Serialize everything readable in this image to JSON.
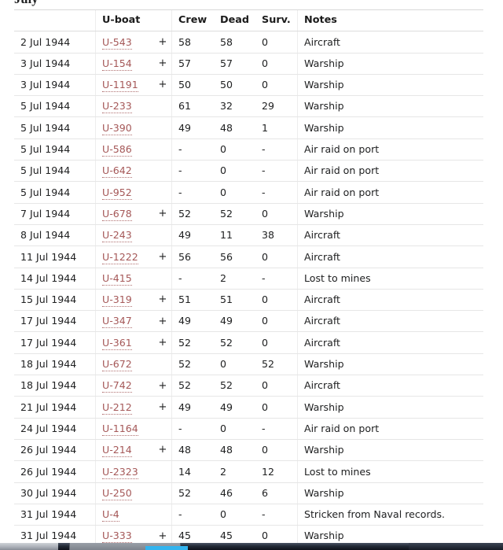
{
  "section": {
    "heading": "July"
  },
  "table": {
    "columns": [
      {
        "key": "date",
        "label": ""
      },
      {
        "key": "uboat",
        "label": "U-boat"
      },
      {
        "key": "cross",
        "label": ""
      },
      {
        "key": "crew",
        "label": "Crew"
      },
      {
        "key": "dead",
        "label": "Dead"
      },
      {
        "key": "surv",
        "label": "Surv."
      },
      {
        "key": "notes",
        "label": "Notes"
      }
    ],
    "rows": [
      {
        "date": "2 Jul 1944",
        "uboat": "U-543",
        "cross": "+",
        "crew": "58",
        "dead": "58",
        "surv": "0",
        "notes": "Aircraft"
      },
      {
        "date": "3 Jul 1944",
        "uboat": "U-154",
        "cross": "+",
        "crew": "57",
        "dead": "57",
        "surv": "0",
        "notes": "Warship"
      },
      {
        "date": "3 Jul 1944",
        "uboat": "U-1191",
        "cross": "+",
        "crew": "50",
        "dead": "50",
        "surv": "0",
        "notes": "Warship"
      },
      {
        "date": "5 Jul 1944",
        "uboat": "U-233",
        "cross": "",
        "crew": "61",
        "dead": "32",
        "surv": "29",
        "notes": "Warship"
      },
      {
        "date": "5 Jul 1944",
        "uboat": "U-390",
        "cross": "",
        "crew": "49",
        "dead": "48",
        "surv": "1",
        "notes": "Warship"
      },
      {
        "date": "5 Jul 1944",
        "uboat": "U-586",
        "cross": "",
        "crew": "-",
        "dead": "0",
        "surv": "-",
        "notes": "Air raid on port"
      },
      {
        "date": "5 Jul 1944",
        "uboat": "U-642",
        "cross": "",
        "crew": "-",
        "dead": "0",
        "surv": "-",
        "notes": "Air raid on port"
      },
      {
        "date": "5 Jul 1944",
        "uboat": "U-952",
        "cross": "",
        "crew": "-",
        "dead": "0",
        "surv": "-",
        "notes": "Air raid on port"
      },
      {
        "date": "7 Jul 1944",
        "uboat": "U-678",
        "cross": "+",
        "crew": "52",
        "dead": "52",
        "surv": "0",
        "notes": "Warship"
      },
      {
        "date": "8 Jul 1944",
        "uboat": "U-243",
        "cross": "",
        "crew": "49",
        "dead": "11",
        "surv": "38",
        "notes": "Aircraft"
      },
      {
        "date": "11 Jul 1944",
        "uboat": "U-1222",
        "cross": "+",
        "crew": "56",
        "dead": "56",
        "surv": "0",
        "notes": "Aircraft"
      },
      {
        "date": "14 Jul 1944",
        "uboat": "U-415",
        "cross": "",
        "crew": "-",
        "dead": "2",
        "surv": "-",
        "notes": "Lost to mines"
      },
      {
        "date": "15 Jul 1944",
        "uboat": "U-319",
        "cross": "+",
        "crew": "51",
        "dead": "51",
        "surv": "0",
        "notes": "Aircraft"
      },
      {
        "date": "17 Jul 1944",
        "uboat": "U-347",
        "cross": "+",
        "crew": "49",
        "dead": "49",
        "surv": "0",
        "notes": "Aircraft"
      },
      {
        "date": "17 Jul 1944",
        "uboat": "U-361",
        "cross": "+",
        "crew": "52",
        "dead": "52",
        "surv": "0",
        "notes": "Aircraft"
      },
      {
        "date": "18 Jul 1944",
        "uboat": "U-672",
        "cross": "",
        "crew": "52",
        "dead": "0",
        "surv": "52",
        "notes": "Warship"
      },
      {
        "date": "18 Jul 1944",
        "uboat": "U-742",
        "cross": "+",
        "crew": "52",
        "dead": "52",
        "surv": "0",
        "notes": "Aircraft"
      },
      {
        "date": "21 Jul 1944",
        "uboat": "U-212",
        "cross": "+",
        "crew": "49",
        "dead": "49",
        "surv": "0",
        "notes": "Warship"
      },
      {
        "date": "24 Jul 1944",
        "uboat": "U-1164",
        "cross": "",
        "crew": "-",
        "dead": "0",
        "surv": "-",
        "notes": "Air raid on port"
      },
      {
        "date": "26 Jul 1944",
        "uboat": "U-214",
        "cross": "+",
        "crew": "48",
        "dead": "48",
        "surv": "0",
        "notes": "Warship"
      },
      {
        "date": "26 Jul 1944",
        "uboat": "U-2323",
        "cross": "",
        "crew": "14",
        "dead": "2",
        "surv": "12",
        "notes": "Lost to mines"
      },
      {
        "date": "30 Jul 1944",
        "uboat": "U-250",
        "cross": "",
        "crew": "52",
        "dead": "46",
        "surv": "6",
        "notes": "Warship"
      },
      {
        "date": "31 Jul 1944",
        "uboat": "U-4",
        "cross": "",
        "crew": "-",
        "dead": "0",
        "surv": "-",
        "notes": "Stricken from Naval records."
      },
      {
        "date": "31 Jul 1944",
        "uboat": "U-333",
        "cross": "+",
        "crew": "45",
        "dead": "45",
        "surv": "0",
        "notes": "Warship"
      }
    ]
  },
  "colors": {
    "link": "#a55858",
    "text": "#202122",
    "row_border": "#e6e6e6",
    "taskbar_accent": "#32b4ef"
  }
}
